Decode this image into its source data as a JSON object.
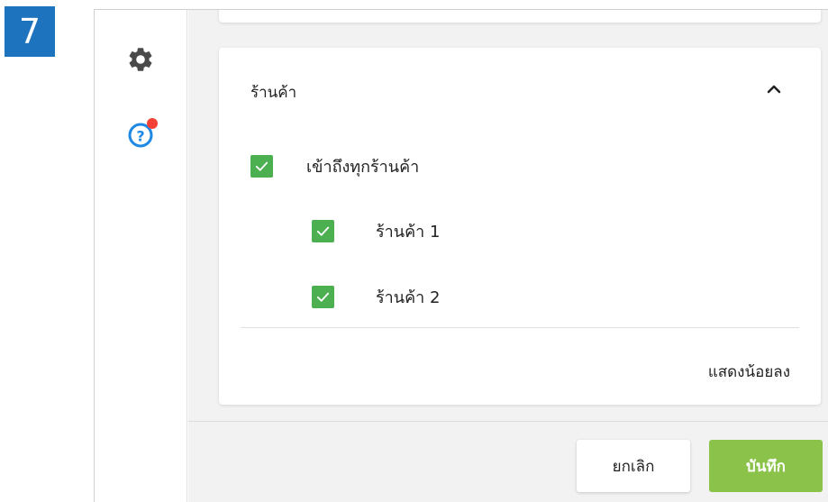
{
  "step": {
    "number": "7",
    "color": "#1e73be"
  },
  "sidebar": {
    "icons": [
      {
        "name": "gear-icon"
      },
      {
        "name": "help-icon",
        "badge": "notification-dot"
      }
    ]
  },
  "store_section": {
    "title": "ร้านค้า",
    "expanded": true,
    "access_all": {
      "label": "เข้าถึงทุกร้านค้า",
      "checked": true
    },
    "stores": [
      {
        "label": "ร้านค้า 1",
        "checked": true
      },
      {
        "label": "ร้านค้า 2",
        "checked": true
      }
    ],
    "show_less_label": "แสดงน้อยลง"
  },
  "footer": {
    "cancel_label": "ยกเลิก",
    "save_label": "บันทึก"
  },
  "colors": {
    "checkbox": "#4caf50",
    "save_button": "#8bc34a",
    "help_icon": "#1e88e5",
    "badge": "#f44336"
  }
}
